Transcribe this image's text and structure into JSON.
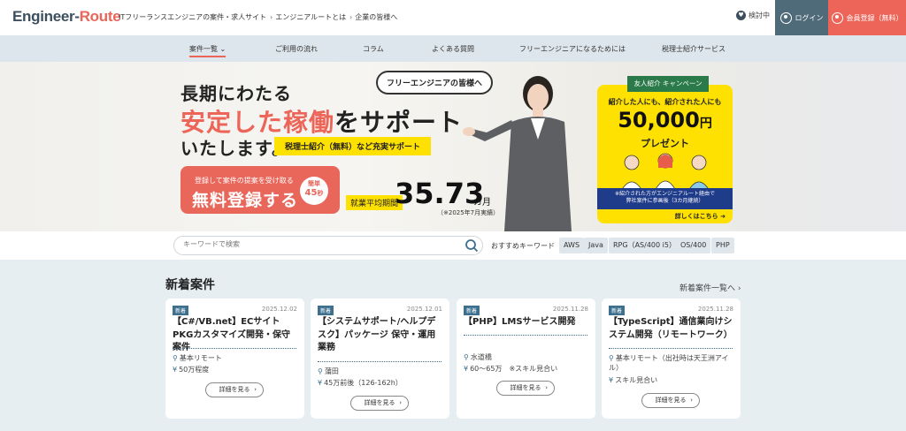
{
  "header": {
    "logo_main": "Engineer-",
    "logo_accent": "Route",
    "tagline": "ITフリーランスエンジニアの案件・求人サイト",
    "links": [
      "エンジニアルートとは",
      "企業の皆様へ"
    ],
    "favorites_label": "検討中",
    "login_label": "ログイン",
    "register_label": "会員登録（無料）"
  },
  "nav": {
    "items": [
      "案件一覧",
      "ご利用の流れ",
      "コラム",
      "よくある質問",
      "フリーエンジニアになるためには",
      "税理士紹介サービス"
    ]
  },
  "hero": {
    "line1": "長期にわたる",
    "line2_em": "安定した稼働",
    "line2_rest": "をサポート",
    "line3": "いたします。",
    "bubble": "フリーエンジニアの皆様へ",
    "tax_tag": "税理士紹介（無料）など充実サポート",
    "cta_sub": "登録して案件の提案を受け取る",
    "cta_main": "無料登録する",
    "cta_badge_top": "簡単",
    "cta_badge_num": "45",
    "cta_badge_unit": "秒",
    "avg_label": "就業平均期間",
    "avg_value": "35.73",
    "avg_unit": "カ月",
    "avg_note": "（※2025年7月実績）"
  },
  "promo": {
    "flag": "友人紹介 キャンペーン",
    "line1": "紹介した人にも、紹介された人にも",
    "amount": "50,000",
    "amount_unit": "円",
    "line3": "プレゼント",
    "note1": "※紹介された方がエンジニアルート経由で",
    "note2": "弊社案件に参画後（3カ月継続）",
    "more": "詳しくはこちら"
  },
  "search": {
    "placeholder": "キーワードで検索",
    "keyword_label": "おすすめキーワード",
    "keywords": [
      "AWS",
      "Java",
      "RPG（AS/400 i5）",
      "OS/400",
      "PHP"
    ]
  },
  "listings": {
    "title": "新着案件",
    "more": "新着案件一覧へ",
    "badge": "新着",
    "button": "詳細を見る",
    "cards": [
      {
        "date": "2025.12.02",
        "title": "【C#/VB.net】ECサイトPKGカスタマイズ開発・保守案件",
        "location": "基本リモート",
        "price": "50万程度"
      },
      {
        "date": "2025.12.01",
        "title": "【システムサポート/ヘルプデスク】パッケージ 保守・運用業務",
        "location": "蒲田",
        "price": "45万前後（126-162h）"
      },
      {
        "date": "2025.11.28",
        "title": "【PHP】LMSサービス開発",
        "location": "水道橋",
        "price": "60〜65万　※スキル見合い"
      },
      {
        "date": "2025.11.28",
        "title": "【TypeScript】通信業向けシステム開発（リモートワーク）",
        "location": "基本リモート（出社時は天王洲アイル）",
        "price": "スキル見合い"
      }
    ]
  }
}
